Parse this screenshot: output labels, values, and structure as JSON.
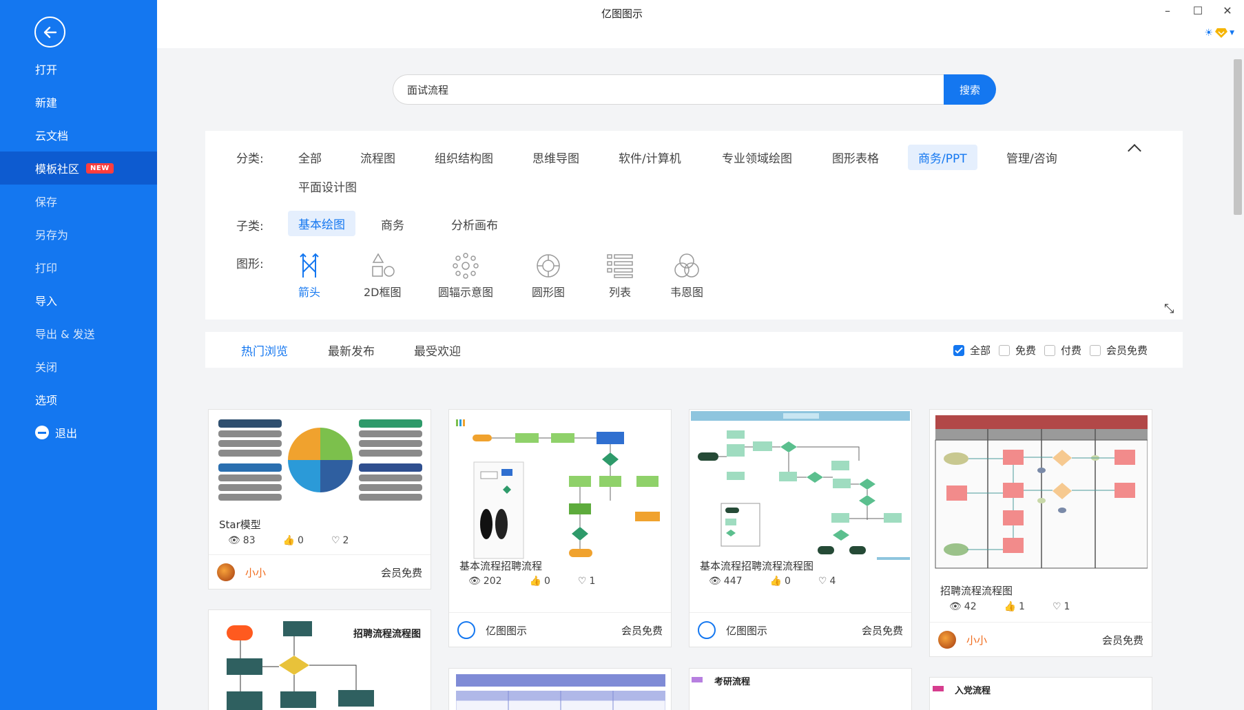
{
  "window": {
    "title": "亿图图示"
  },
  "sidebar": {
    "items": [
      {
        "label": "打开"
      },
      {
        "label": "新建"
      },
      {
        "label": "云文档"
      },
      {
        "label": "模板社区",
        "badge": "NEW"
      },
      {
        "label": "保存"
      },
      {
        "label": "另存为"
      },
      {
        "label": "打印"
      },
      {
        "label": "导入"
      },
      {
        "label": "导出 & 发送"
      },
      {
        "label": "关闭"
      },
      {
        "label": "选项"
      },
      {
        "label": "退出"
      }
    ]
  },
  "search": {
    "value": "面试流程",
    "button": "搜索"
  },
  "filter": {
    "category_label": "分类:",
    "categories": [
      "全部",
      "流程图",
      "组织结构图",
      "思维导图",
      "软件/计算机",
      "专业领域绘图",
      "图形表格",
      "商务/PPT",
      "管理/咨询",
      "平面设计图"
    ],
    "selected_category": "商务/PPT",
    "subcategory_label": "子类:",
    "subcategories": [
      "基本绘图",
      "商务",
      "分析画布"
    ],
    "shape_label": "图形:",
    "shapes": [
      "箭头",
      "2D框图",
      "圆辐示意图",
      "圆形图",
      "列表",
      "韦恩图"
    ]
  },
  "tabs": [
    "热门浏览",
    "最新发布",
    "最受欢迎"
  ],
  "price_filters": [
    "全部",
    "免费",
    "付费",
    "会员免费"
  ],
  "cards": [
    {
      "name": "Star模型",
      "views": "83",
      "likes": "0",
      "favs": "2",
      "author": "小小",
      "price": "会员免费"
    },
    {
      "name": "基本流程招聘流程",
      "views": "202",
      "likes": "0",
      "favs": "1",
      "author": "亿图图示",
      "price": "会员免费"
    },
    {
      "name": "基本流程招聘流程流程图",
      "views": "447",
      "likes": "0",
      "favs": "4",
      "author": "亿图图示",
      "price": "会员免费"
    },
    {
      "name": "招聘流程流程图",
      "views": "42",
      "likes": "1",
      "favs": "1",
      "author": "小小",
      "price": "会员免费"
    }
  ],
  "partial_cards": [
    {
      "thumb_title": "招聘流程流程图"
    },
    {
      "thumb_title": "考研流程"
    },
    {
      "thumb_title": "入党流程"
    }
  ],
  "colors": {
    "accent": "#1477f0",
    "sidebar": "#1477f0",
    "author_orange": "#f06a1b"
  }
}
